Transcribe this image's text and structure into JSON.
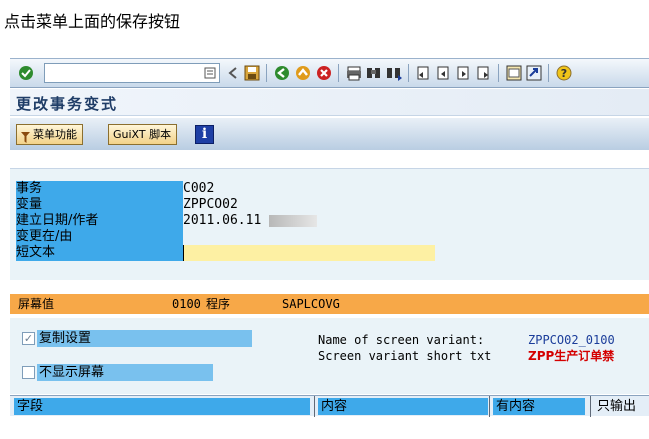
{
  "caption": "点击菜单上面的保存按钮",
  "toolbar": {
    "command_value": "",
    "icons": [
      "enter-check-icon",
      "save-icon",
      "back-icon",
      "exit-icon",
      "cancel-icon",
      "print-icon",
      "find-icon",
      "find-next-icon",
      "first-page-icon",
      "prev-page-icon",
      "next-page-icon",
      "last-page-icon",
      "new-session-icon",
      "shortcut-icon",
      "help-icon"
    ]
  },
  "title": "更改事务变式",
  "app_toolbar": {
    "menu_button": "菜单功能",
    "guixt_button": "GuiXT 脚本",
    "info_button": "i"
  },
  "header": {
    "fields": [
      {
        "label": "事务",
        "value": "C002"
      },
      {
        "label": "变量",
        "value": "ZPPCO02"
      },
      {
        "label": "建立日期/作者",
        "value": "2011.06.11"
      },
      {
        "label": "变更在/由",
        "value": ""
      },
      {
        "label": "短文本",
        "value": ""
      }
    ]
  },
  "screen": {
    "heading": "屏幕值",
    "screen_no": "0100",
    "program_label": "程序",
    "program": "SAPLCOVG",
    "copy_settings": "复制设置",
    "copy_settings_checked": true,
    "hide_screen": "不显示屏幕",
    "hide_screen_checked": false,
    "variant_name_label": "Name of screen variant:",
    "variant_name": "ZPPCO02_0100",
    "variant_short_label": "Screen variant short txt",
    "variant_short": "ZPP生产订单禁"
  },
  "table": {
    "columns": [
      "字段",
      "内容",
      "有内容",
      "只输出"
    ]
  },
  "colors": {
    "label_blue": "#3ea9ea",
    "orange_header": "#f7a848",
    "short_text_yellow": "#fdf0a3",
    "red_text": "#d40000"
  }
}
